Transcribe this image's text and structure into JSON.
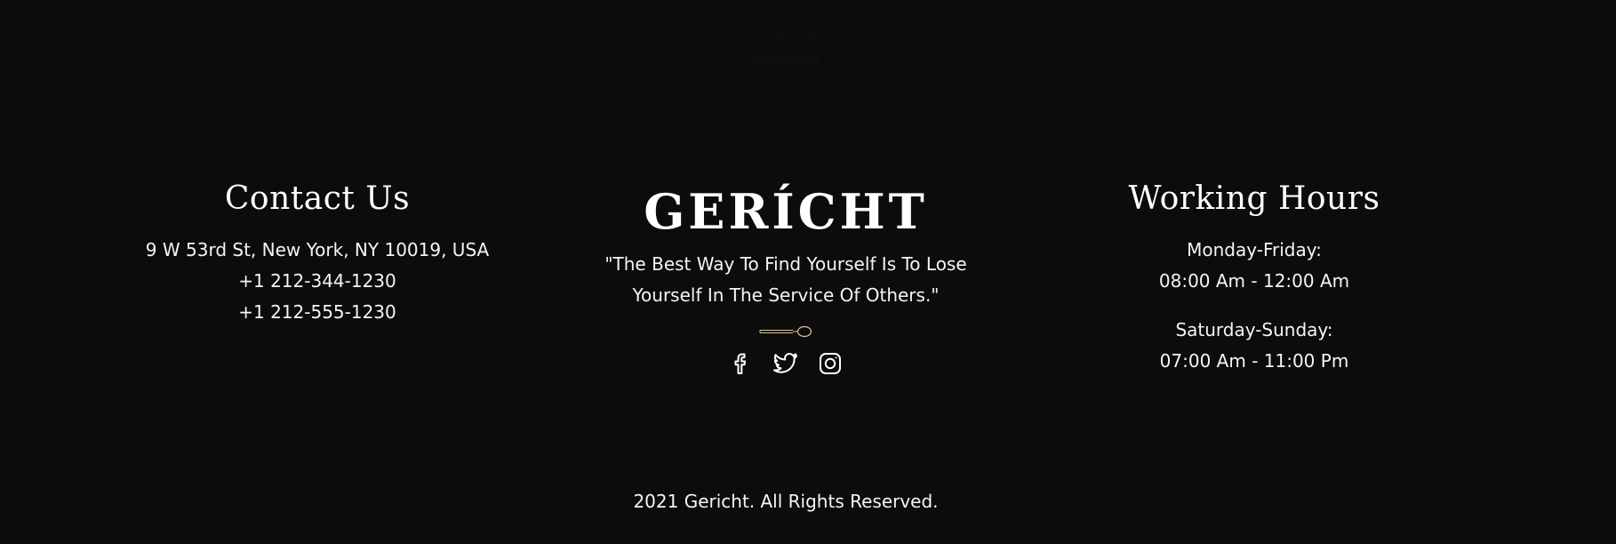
{
  "overlay": {
    "footer_overlay": "FooterOverlay",
    "newsletter": "Newsletter"
  },
  "contact": {
    "heading": "Contact Us",
    "address": "9 W 53rd St, New York, NY 10019, USA",
    "phone_1": "+1 212-344-1230",
    "phone_2": "+1 212-555-1230"
  },
  "brand": {
    "logo": "GERÍCHT",
    "quote_line_1": "\"The Best Way To Find Yourself Is To Lose",
    "quote_line_2": "Yourself In The Service Of Others.\"",
    "spoon_icon": "spoon-icon",
    "socials": [
      "facebook-icon",
      "twitter-icon",
      "instagram-icon"
    ],
    "accent_color": "#dcca87"
  },
  "hours": {
    "heading": "Working Hours",
    "weekday_label": "Monday-Friday:",
    "weekday_time": "08:00 Am - 12:00 Am",
    "weekend_label": "Saturday-Sunday:",
    "weekend_time": "07:00 Am - 11:00 Pm"
  },
  "footer": {
    "copyright": "2021 Gericht. All Rights Reserved."
  },
  "colors": {
    "background": "#0c0c0c",
    "text": "#ffffff"
  }
}
